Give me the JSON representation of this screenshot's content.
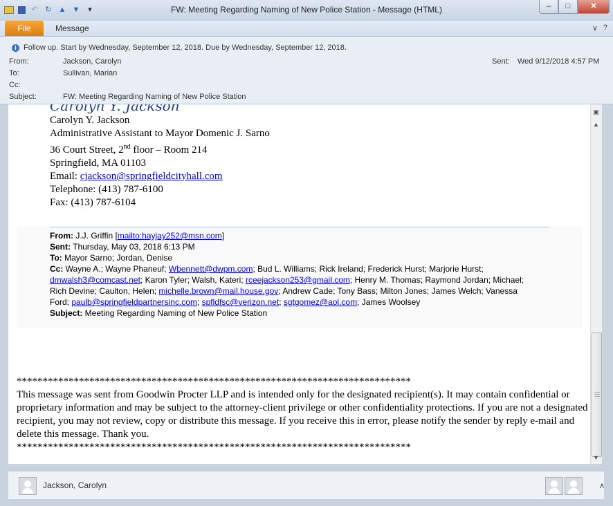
{
  "window": {
    "title": "FW: Meeting Regarding Naming of New Police Station  -  Message (HTML)",
    "controls": {
      "minimize": "–",
      "maximize": "□",
      "close": "✕"
    }
  },
  "ribbon": {
    "file_tab": "File",
    "message_tab": "Message",
    "help_icon": "?"
  },
  "header": {
    "followup": "Follow up.  Start by Wednesday, September 12, 2018.  Due by Wednesday, September 12, 2018.",
    "from_label": "From:",
    "from_value": "Jackson, Carolyn",
    "to_label": "To:",
    "to_value": "Sullivan, Marian",
    "cc_label": "Cc:",
    "cc_value": "",
    "subject_label": "Subject:",
    "subject_value": "FW: Meeting Regarding Naming of New Police Station",
    "sent_label": "Sent:",
    "sent_value": "Wed 9/12/2018 4:57 PM"
  },
  "signature": {
    "script_name": "Carolyn Y. Jackson",
    "name": "Carolyn Y. Jackson",
    "title": "Administrative Assistant to Mayor Domenic J. Sarno",
    "address1_pre": "36 Court Street, 2",
    "address1_sup": "nd",
    "address1_post": " floor – Room 214",
    "address2": "Springfield, MA  01103",
    "email_label": "Email: ",
    "email": "cjackson@springfieldcityhall.com",
    "telephone": "Telephone: (413) 787-6100",
    "fax": "Fax: (413) 787-6104"
  },
  "forwarded": {
    "from_label": "From:",
    "from_name": " J.J. Griffin [",
    "from_link": "mailto:hayjay252@msn.com",
    "from_close": "]",
    "sent_label": "Sent:",
    "sent_value": " Thursday, May 03, 2018 6:13 PM",
    "to_label": "To:",
    "to_value": " Mayor Sarno; Jordan, Denise",
    "cc_label": "Cc:",
    "cc_1": " Wayne A.; Wayne Phaneuf; ",
    "cc_link1": "Wbennett@dwpm.com",
    "cc_2": "; Bud L. Williams; Rick Ireland; Frederick Hurst; Marjorie Hurst; ",
    "cc_link2": "dmwalsh3@comcast.net",
    "cc_3": "; Karon Tyler; Walsh, Kateri; ",
    "cc_link3": "rceejackson253@gmail.com",
    "cc_4": "; Henry M. Thomas; Raymond Jordan; Michael; Rich Devine; Caulton, Helen; ",
    "cc_link4": "michelle.brown@mail.house.gov",
    "cc_5": "; Andrew Cade; Tony Bass; Milton Jones; James Welch; Vanessa Ford; ",
    "cc_link5": "paulb@springfieldpartnersinc.com",
    "cc_6": "; ",
    "cc_link6": "spfldfsc@verizon.net",
    "cc_7": "; ",
    "cc_link7": "sgtgomez@aol.com",
    "cc_8": "; James Woolsey",
    "subject_label": "Subject:",
    "subject_value": " Meeting Regarding Naming of New Police Station"
  },
  "disclaimer": {
    "stars_top": "****************************************************************************",
    "text": "This message was sent from Goodwin Procter LLP and is intended only for the designated recipient(s). It may contain confidential or proprietary information and may be subject to the attorney-client privilege or other confidentiality protections. If you are not a designated recipient, you may not review, copy or distribute this message. If you receive this in error, please notify the sender by reply e-mail and delete this message. Thank you.",
    "stars_bottom": "****************************************************************************"
  },
  "footer": {
    "contact_name": "Jackson, Carolyn",
    "expand_icon": "∧"
  }
}
